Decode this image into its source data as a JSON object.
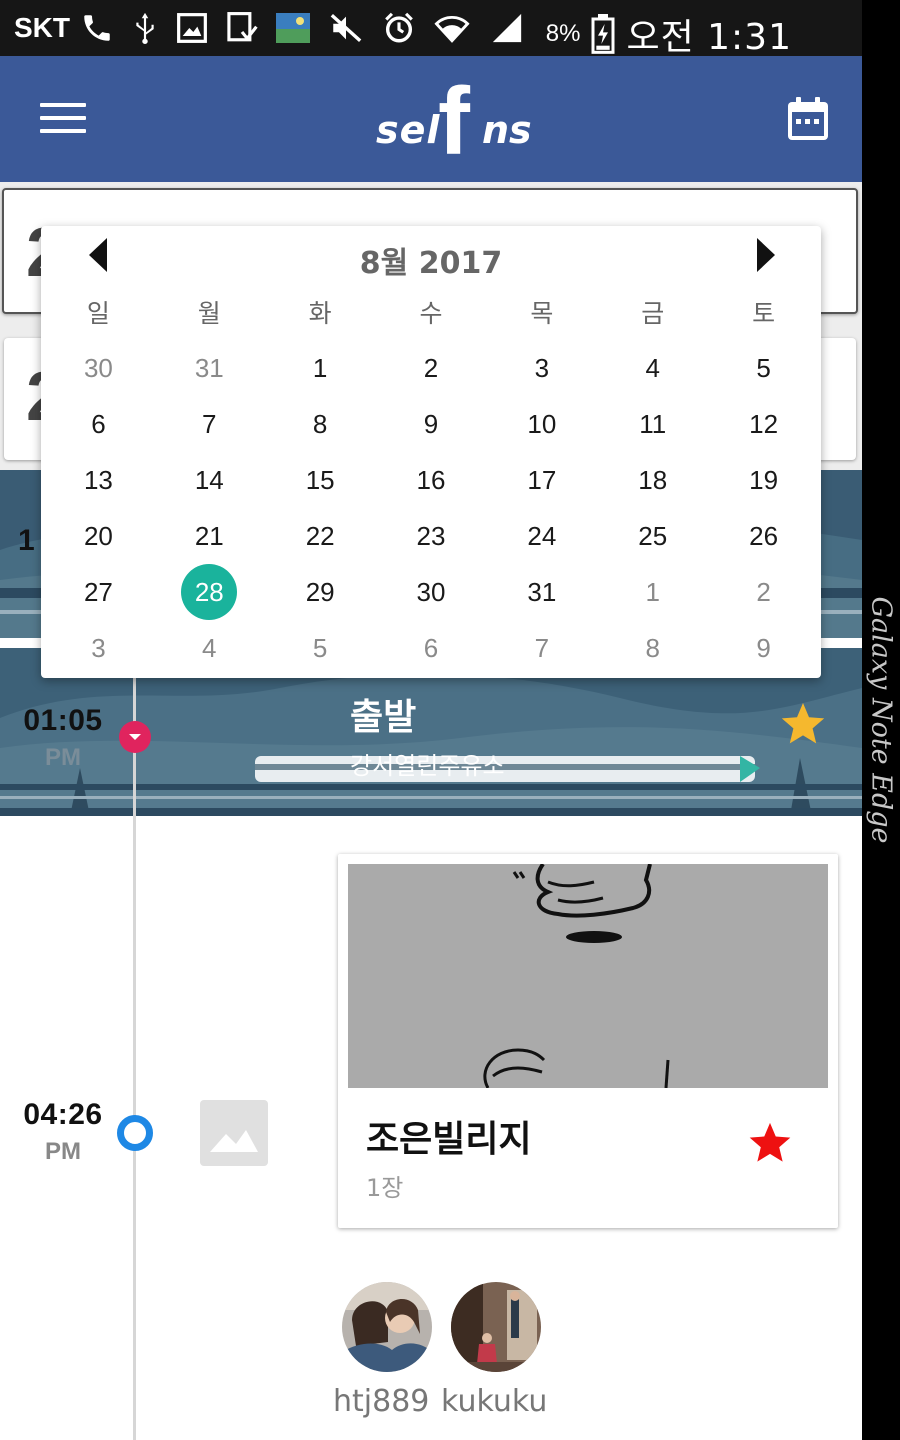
{
  "status_bar": {
    "carrier": "SKT",
    "battery_percent": "8%",
    "time": "오전 1:31",
    "icons": [
      "phone-icon",
      "usb-icon",
      "gallery-icon",
      "download-icon",
      "image-icon",
      "mute-icon",
      "alarm-icon",
      "wifi-icon",
      "signal-icon",
      "battery-icon"
    ]
  },
  "app_bar": {
    "logo_left": "sel",
    "logo_f": "f",
    "logo_right": "ns",
    "menu_icon": "menu-icon",
    "calendar_icon": "calendar-icon",
    "color": "#3b5998"
  },
  "date_picker": {
    "title": "8월 2017",
    "weekdays": [
      "일",
      "월",
      "화",
      "수",
      "목",
      "금",
      "토"
    ],
    "weeks": [
      [
        {
          "d": "30",
          "other": true
        },
        {
          "d": "31",
          "other": true
        },
        {
          "d": "1"
        },
        {
          "d": "2"
        },
        {
          "d": "3"
        },
        {
          "d": "4"
        },
        {
          "d": "5"
        }
      ],
      [
        {
          "d": "6"
        },
        {
          "d": "7"
        },
        {
          "d": "8"
        },
        {
          "d": "9"
        },
        {
          "d": "10"
        },
        {
          "d": "11"
        },
        {
          "d": "12"
        }
      ],
      [
        {
          "d": "13"
        },
        {
          "d": "14"
        },
        {
          "d": "15"
        },
        {
          "d": "16"
        },
        {
          "d": "17"
        },
        {
          "d": "18"
        },
        {
          "d": "19"
        }
      ],
      [
        {
          "d": "20"
        },
        {
          "d": "21"
        },
        {
          "d": "22"
        },
        {
          "d": "23"
        },
        {
          "d": "24"
        },
        {
          "d": "25"
        },
        {
          "d": "26"
        }
      ],
      [
        {
          "d": "27"
        },
        {
          "d": "28",
          "selected": true
        },
        {
          "d": "29"
        },
        {
          "d": "30"
        },
        {
          "d": "31"
        },
        {
          "d": "1",
          "other": true
        },
        {
          "d": "2",
          "other": true
        }
      ],
      [
        {
          "d": "3",
          "other": true
        },
        {
          "d": "4",
          "other": true
        },
        {
          "d": "5",
          "other": true
        },
        {
          "d": "6",
          "other": true
        },
        {
          "d": "7",
          "other": true
        },
        {
          "d": "8",
          "other": true
        },
        {
          "d": "9",
          "other": true
        }
      ]
    ],
    "selected_color": "#1ab39c"
  },
  "timeline": {
    "departure": {
      "time": "01:05",
      "ampm": "PM",
      "title": "출발",
      "subtitle": "강서열린주유소",
      "starred": true,
      "star_color": "#f5b82e"
    },
    "photo_entry": {
      "time": "04:26",
      "ampm": "PM",
      "title": "조은빌리지",
      "count": "1장",
      "starred": true,
      "star_color": "#ee1111"
    },
    "users": [
      {
        "name": "htj889"
      },
      {
        "name": "kukuku"
      }
    ]
  },
  "edge_panel": {
    "text": "Galaxy Note Edge"
  }
}
